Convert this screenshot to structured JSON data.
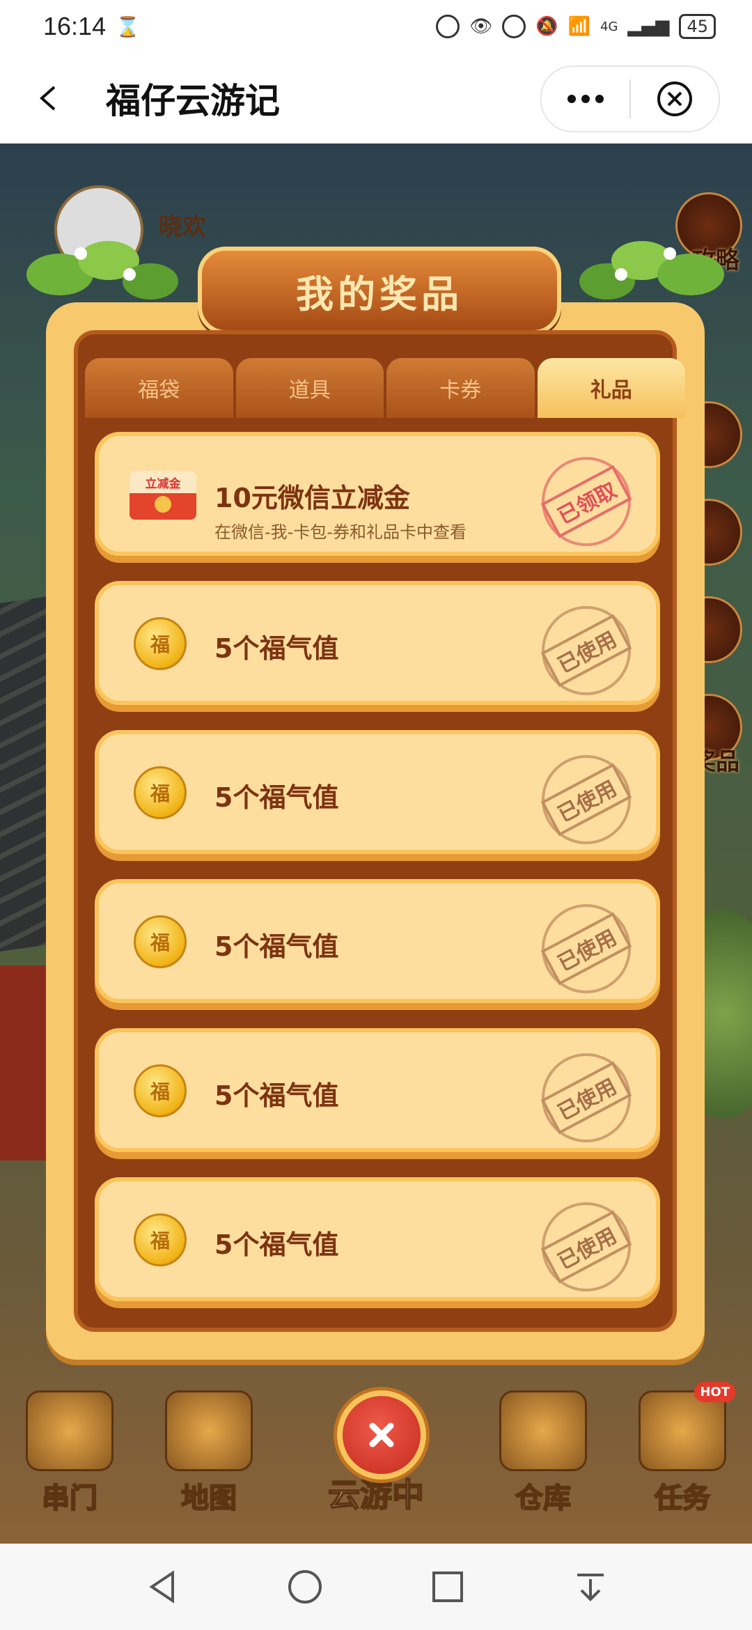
{
  "status_bar": {
    "time": "16:14",
    "battery": "45",
    "network": "4G"
  },
  "nav": {
    "title": "福仔云游记"
  },
  "background": {
    "username": "晓欢",
    "side_buttons": [
      "攻略",
      "奖品"
    ],
    "dock": [
      "串门",
      "地图",
      "云游中",
      "仓库",
      "任务"
    ],
    "hot_badge": "HOT"
  },
  "dialog": {
    "title": "我的奖品",
    "tabs": [
      {
        "label": "福袋",
        "active": false
      },
      {
        "label": "道具",
        "active": false
      },
      {
        "label": "卡券",
        "active": false
      },
      {
        "label": "礼品",
        "active": true
      }
    ],
    "items": [
      {
        "type": "envelope",
        "icon_text": "立减金",
        "title": "10元微信立减金",
        "subtitle": "在微信-我-卡包-券和礼品卡中查看",
        "status": "已领取",
        "icon": "red-envelope-icon"
      },
      {
        "type": "coin",
        "icon_text": "福",
        "title": "5个福气值",
        "status": "已使用",
        "icon": "coin-icon"
      },
      {
        "type": "coin",
        "icon_text": "福",
        "title": "5个福气值",
        "status": "已使用",
        "icon": "coin-icon"
      },
      {
        "type": "coin",
        "icon_text": "福",
        "title": "5个福气值",
        "status": "已使用",
        "icon": "coin-icon"
      },
      {
        "type": "coin",
        "icon_text": "福",
        "title": "5个福气值",
        "status": "已使用",
        "icon": "coin-icon"
      },
      {
        "type": "coin",
        "icon_text": "福",
        "title": "5个福气值",
        "status": "已使用",
        "icon": "coin-icon"
      }
    ]
  },
  "colors": {
    "accent": "#8f3f12",
    "panel": "#fdde9f",
    "claimed": "#e0505a"
  }
}
